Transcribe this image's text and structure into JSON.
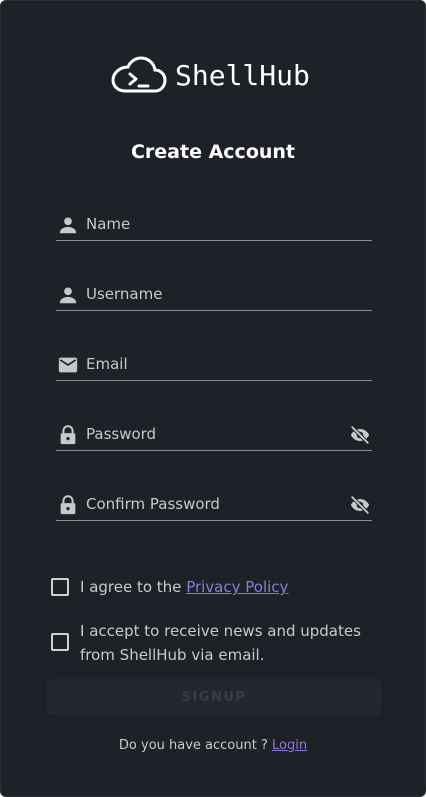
{
  "brand": {
    "name": "ShellHub",
    "logo_icon": "cloud-terminal-icon"
  },
  "form": {
    "title": "Create Account",
    "fields": [
      {
        "placeholder": "Name",
        "icon": "person-icon",
        "value": ""
      },
      {
        "placeholder": "Username",
        "icon": "person-icon",
        "value": ""
      },
      {
        "placeholder": "Email",
        "icon": "mail-icon",
        "value": ""
      },
      {
        "placeholder": "Password",
        "icon": "lock-icon",
        "value": "",
        "toggle_icon": "eye-off-icon"
      },
      {
        "placeholder": "Confirm Password",
        "icon": "lock-icon",
        "value": "",
        "toggle_icon": "eye-off-icon"
      }
    ],
    "privacy": {
      "label_prefix": "I agree to the ",
      "link_text": "Privacy Policy",
      "checked": false
    },
    "newsletter": {
      "label": "I accept to receive news and updates from ShellHub via email.",
      "checked": false
    },
    "submit_label": "SIGNUP",
    "submit_enabled": false
  },
  "footer": {
    "text": "Do you have account ? ",
    "login_link": "Login"
  },
  "colors": {
    "background": "#1e2127",
    "link": "#8c7bd8",
    "text": "#c9cacf"
  }
}
